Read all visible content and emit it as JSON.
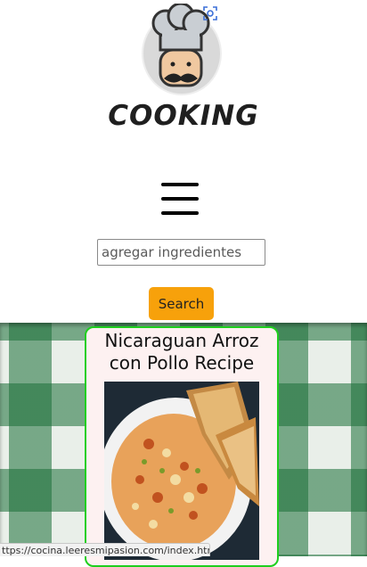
{
  "header": {
    "logo_text": "COOKING",
    "search": {
      "placeholder": "agregar ingredientes",
      "value": ""
    },
    "search_button_label": "Search"
  },
  "recipe_card": {
    "title": "Nicaraguan Arroz con Pollo Recipe",
    "border_color": "#1ecf1e"
  },
  "status_bar": {
    "url": "ttps://cocina.leeresmipasion.com/index.html"
  },
  "colors": {
    "accent": "#f7a10b",
    "tablecloth": "#1e6e37"
  },
  "icons": [
    "chef-logo-icon",
    "lens-icon",
    "hamburger-menu-icon"
  ]
}
